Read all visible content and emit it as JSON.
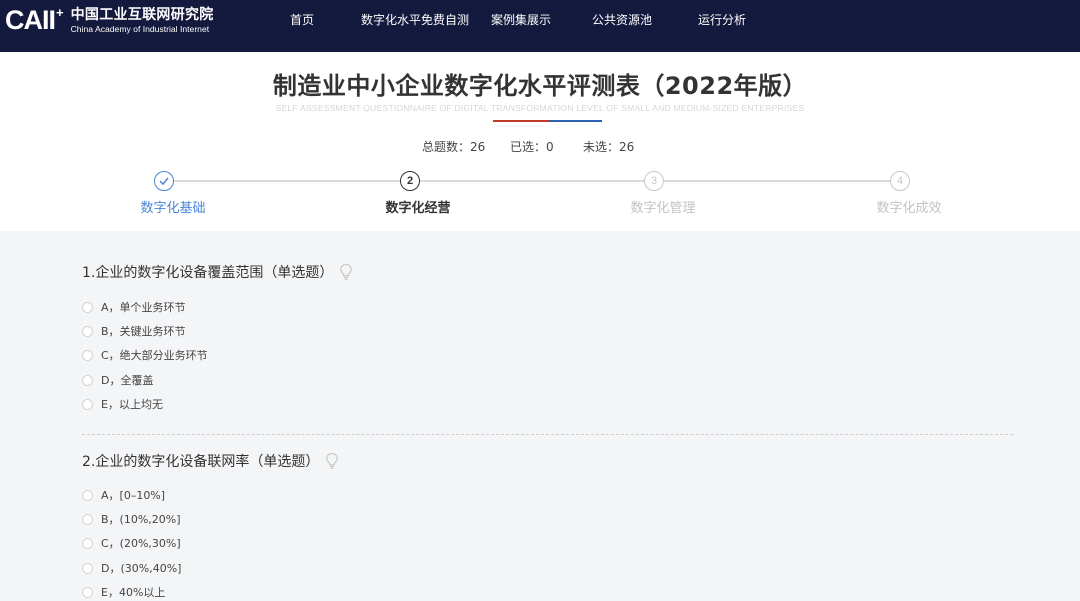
{
  "header": {
    "logo_mark": "CAII",
    "logo_plus": "+",
    "logo_cn": "中国工业互联网研究院",
    "logo_en": "China Academy of Industrial Internet",
    "nav": [
      "首页",
      "数字化水平免费自测",
      "案例集展示",
      "公共资源池",
      "运行分析"
    ]
  },
  "page": {
    "title": "制造业中小企业数字化水平评测表（2022年版）",
    "subtitle": "SELF ASSESSMENT QUESTIONNAIRE OF DIGITAL TRANSFORMATION LEVEL OF SMALL AND MEDIUM-SIZED ENTERPRISES",
    "accent_red": "#c0392b",
    "accent_blue": "#2a62b0"
  },
  "stats": {
    "total_label": "总题数：",
    "total_value": "26",
    "selected_label": "已选：",
    "selected_value": "0",
    "unselected_label": "未选：",
    "unselected_value": "26"
  },
  "steps": [
    {
      "label": "数字化基础",
      "marker": "check-icon",
      "state": "done"
    },
    {
      "label": "数字化经营",
      "marker": "2",
      "state": "active"
    },
    {
      "label": "数字化管理",
      "marker": "3",
      "state": "pending"
    },
    {
      "label": "数字化成效",
      "marker": "4",
      "state": "pending"
    }
  ],
  "questions": [
    {
      "title": "1.企业的数字化设备覆盖范围（单选题）",
      "icon": "lightbulb-icon",
      "options": [
        "A，单个业务环节",
        "B，关键业务环节",
        "C，绝大部分业务环节",
        "D，全覆盖",
        "E，以上均无"
      ]
    },
    {
      "title": "2.企业的数字化设备联网率（单选题）",
      "icon": "lightbulb-icon",
      "options": [
        "A，[0–10%]",
        "B，(10%,20%]",
        "C，(20%,30%]",
        "D，(30%,40%]",
        "E，40%以上"
      ]
    }
  ]
}
